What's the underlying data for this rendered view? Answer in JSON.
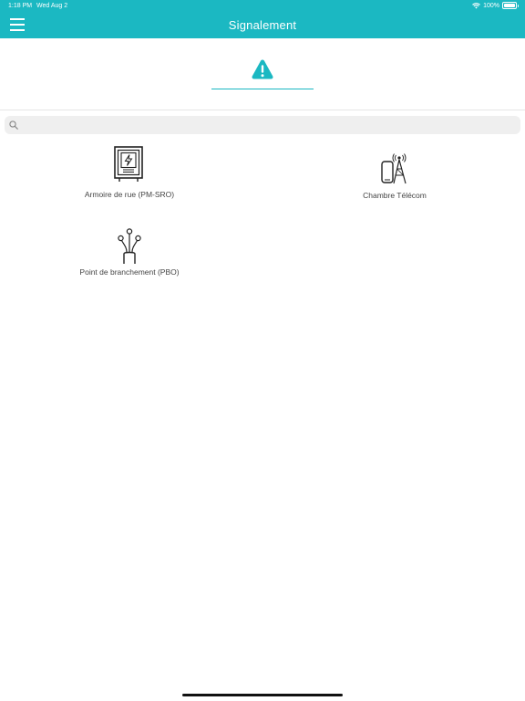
{
  "status_bar": {
    "time": "1:18 PM",
    "date": "Wed Aug 2",
    "battery": "100%"
  },
  "header": {
    "title": "Signalement",
    "menu_icon": "hamburger-menu-icon",
    "background": "#1bb8c2"
  },
  "tabs": [
    {
      "icon": "warning-icon",
      "selected": true
    }
  ],
  "search": {
    "placeholder": "",
    "value": ""
  },
  "items": [
    {
      "label": "Armoire de rue (PM-SRO)",
      "icon": "electrical-cabinet-icon"
    },
    {
      "label": "Chambre Télécom",
      "icon": "telecom-tower-icon"
    },
    {
      "label": "Point de branchement (PBO)",
      "icon": "fiber-connection-icon"
    }
  ],
  "colors": {
    "accent": "#1bb8c2",
    "text": "#444444"
  }
}
